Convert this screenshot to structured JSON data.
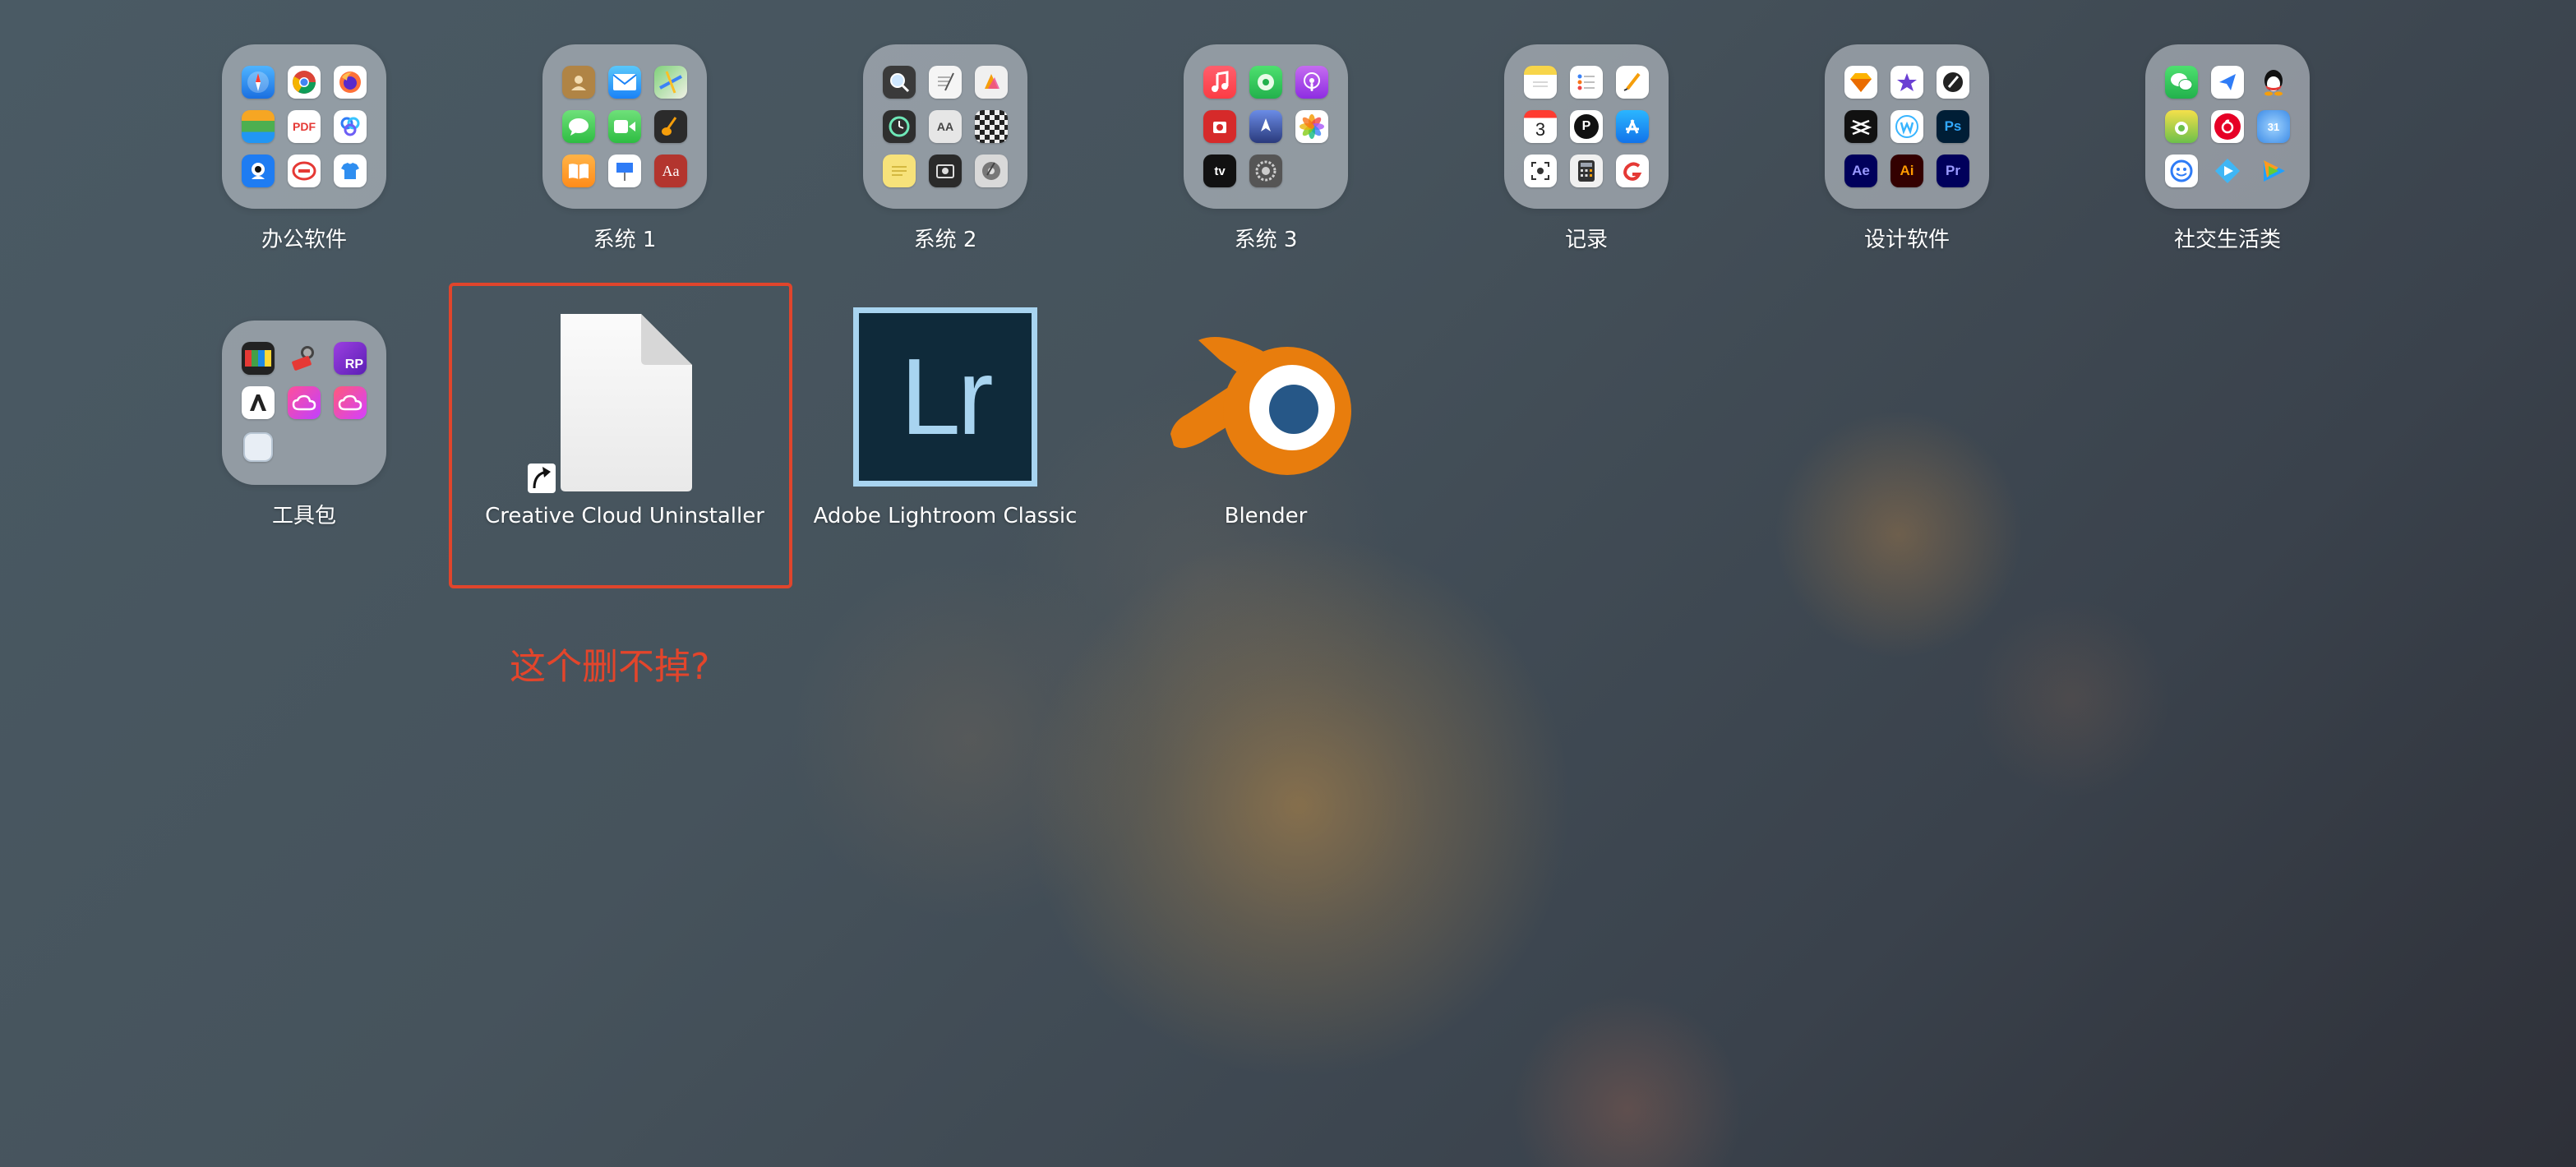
{
  "folders": [
    {
      "label": "办公软件"
    },
    {
      "label": "系统 1"
    },
    {
      "label": "系统 2"
    },
    {
      "label": "系统 3"
    },
    {
      "label": "记录"
    },
    {
      "label": "设计软件"
    },
    {
      "label": "社交生活类"
    },
    {
      "label": "工具包"
    }
  ],
  "apps": [
    {
      "label": "Creative Cloud Uninstaller",
      "icon": "blank-document-icon",
      "shortcut": true
    },
    {
      "label": "Adobe Lightroom Classic",
      "icon_text": "Lr",
      "icon_bg": "#0f2a3a",
      "icon_accent": "#a8d4f0"
    },
    {
      "label": "Blender",
      "icon": "blender-icon",
      "icon_colors": [
        "#e87d0d",
        "#265787",
        "#ffffff"
      ]
    }
  ],
  "mini_icon_text": {
    "pdf": "PDF",
    "rp": "RP",
    "ps": "Ps",
    "ae": "Ae",
    "ai": "Ai",
    "pr": "Pr",
    "aa": "Aa",
    "calendar_day": "3",
    "tv": "tv",
    "p": "P",
    "aag": "AA",
    "num": "31"
  },
  "annotation": {
    "text": "这个删不掉?",
    "color": "#e3452b"
  },
  "highlight_color": "#e0452c"
}
